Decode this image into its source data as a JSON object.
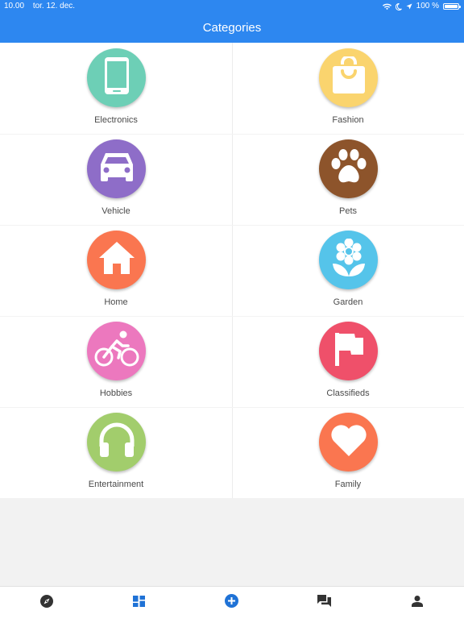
{
  "status": {
    "time": "10.00",
    "date": "tor. 12. dec.",
    "battery": "100 %",
    "battery_level": 1.0
  },
  "nav": {
    "title": "Categories"
  },
  "categories": [
    {
      "label": "Electronics",
      "color": "#6dcfb6",
      "icon": "phone-icon"
    },
    {
      "label": "Fashion",
      "color": "#fad46e",
      "icon": "shopping-bag-icon"
    },
    {
      "label": "Vehicle",
      "color": "#8e6dc8",
      "icon": "car-icon"
    },
    {
      "label": "Pets",
      "color": "#8d542b",
      "icon": "paw-icon"
    },
    {
      "label": "Home",
      "color": "#fa7650",
      "icon": "house-icon"
    },
    {
      "label": "Garden",
      "color": "#55c4ea",
      "icon": "flower-icon"
    },
    {
      "label": "Hobbies",
      "color": "#ec78be",
      "icon": "cyclist-icon"
    },
    {
      "label": "Classifieds",
      "color": "#ef506a",
      "icon": "flag-icon"
    },
    {
      "label": "Entertainment",
      "color": "#a2cd6c",
      "icon": "headphones-icon"
    },
    {
      "label": "Family",
      "color": "#fa7650",
      "icon": "heart-icon"
    }
  ],
  "tabs": [
    {
      "icon": "compass-icon",
      "active": false
    },
    {
      "icon": "dashboard-icon",
      "active": true
    },
    {
      "icon": "add-icon",
      "active": false
    },
    {
      "icon": "chat-icon",
      "active": false
    },
    {
      "icon": "profile-icon",
      "active": false
    }
  ],
  "colors": {
    "primary": "#2d87f0",
    "tab_icon": "#333333",
    "tab_active": "#1f72d6"
  }
}
